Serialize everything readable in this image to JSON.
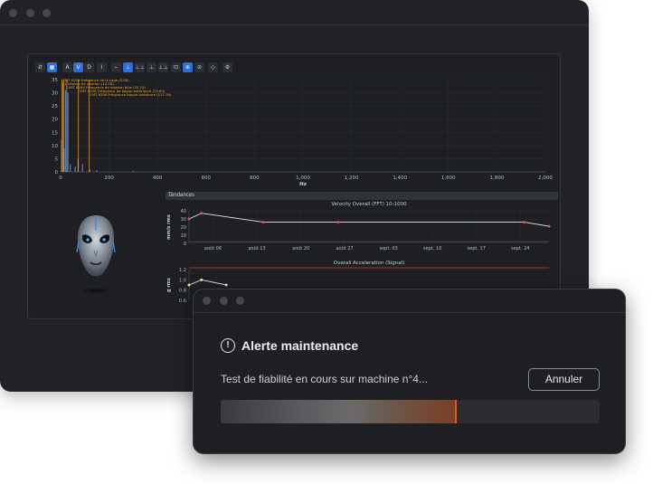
{
  "toolbar": {
    "buttons": [
      {
        "label": "⇵",
        "icon": "cursor-icon",
        "active": false
      },
      {
        "label": "▦",
        "icon": "select-icon",
        "active": true
      },
      {
        "label": "A",
        "icon": "a-icon",
        "active": false
      },
      {
        "label": "V",
        "icon": "v-icon",
        "active": true
      },
      {
        "label": "D",
        "icon": "d-icon",
        "active": false
      },
      {
        "label": "I",
        "icon": "i-icon",
        "active": false
      },
      {
        "label": "⎯",
        "icon": "line-icon",
        "active": false
      },
      {
        "label": "⊥",
        "icon": "marker-icon",
        "active": true
      },
      {
        "label": "⊥⊥",
        "icon": "harmonic-icon",
        "active": false
      },
      {
        "label": "⊥",
        "icon": "sideband-icon",
        "active": false
      },
      {
        "label": "⊥⊥",
        "icon": "peaks-icon",
        "active": false
      },
      {
        "label": "⊡",
        "icon": "zoom-icon",
        "active": false
      },
      {
        "label": "⊕",
        "icon": "zoom-in-icon",
        "active": true
      },
      {
        "label": "⊘",
        "icon": "reset-icon",
        "active": false
      },
      {
        "label": "◇",
        "icon": "fit-icon",
        "active": false
      },
      {
        "label": "⚙",
        "icon": "settings-icon",
        "active": false
      }
    ]
  },
  "chart_data": [
    {
      "type": "bar",
      "title": "",
      "xlabel": "Hz",
      "ylabel": "",
      "xlim": [
        0,
        2000
      ],
      "ylim": [
        0,
        35
      ],
      "x_ticks": [
        "0",
        "200",
        "400",
        "600",
        "800",
        "1,000",
        "1,200",
        "1,400",
        "1,600",
        "1,800",
        "2,000"
      ],
      "y_ticks": [
        "0",
        "5",
        "10",
        "15",
        "20",
        "25",
        "30",
        "35"
      ],
      "bars": [
        {
          "x": 4,
          "y": 12
        },
        {
          "x": 10,
          "y": 34
        },
        {
          "x": 14,
          "y": 9
        },
        {
          "x": 20,
          "y": 31
        },
        {
          "x": 30,
          "y": 30
        },
        {
          "x": 40,
          "y": 3
        },
        {
          "x": 60,
          "y": 2
        },
        {
          "x": 72,
          "y": 5
        },
        {
          "x": 90,
          "y": 3
        },
        {
          "x": 120,
          "y": 1
        },
        {
          "x": 150,
          "y": 0.6
        },
        {
          "x": 300,
          "y": 0.4
        }
      ],
      "markers": [
        {
          "x": 5.08,
          "label": "1MT 6206 Fréquence de la cage (5.08)"
        },
        {
          "x": 12.28,
          "label": "1 Vitesse de rotation (12.28)"
        },
        {
          "x": 25.7,
          "label": "1MT 6206 Fréquence de rotation bille (25.70)"
        },
        {
          "x": 73.6,
          "label": "1MT 6206 Fréquence de bague extérieure (73.60)"
        },
        {
          "x": 117.36,
          "label": "1MT 6206 Fréquence bague intérieure (117.36)"
        }
      ]
    },
    {
      "type": "line",
      "title": "Velocity Overall (FFT) 10-1000",
      "xlabel": "",
      "ylabel": "mm/s rms",
      "ylim": [
        0,
        40
      ],
      "y_ticks": [
        "0",
        "10",
        "20",
        "30",
        "40"
      ],
      "x_ticks": [
        "août 06",
        "août 13",
        "août 20",
        "août 27",
        "sept. 03",
        "sept. 10",
        "sept. 17",
        "sept. 24"
      ],
      "x_range": [
        0,
        29
      ],
      "series": [
        {
          "name": "",
          "x": [
            0,
            1,
            6,
            12,
            27,
            29
          ],
          "values": [
            30,
            37,
            26,
            26,
            26,
            21
          ]
        }
      ],
      "alarm_level": 2
    },
    {
      "type": "line",
      "title": "Overall Acceleration (Signal)",
      "xlabel": "",
      "ylabel": "g rms",
      "ylim": [
        0.6,
        1.2
      ],
      "y_ticks": [
        "0.6",
        "0.8",
        "1.0",
        "1.2"
      ],
      "x_range": [
        0,
        29
      ],
      "series": [
        {
          "name": "",
          "x": [
            0,
            1,
            3
          ],
          "values": [
            0.9,
            1.0,
            0.9
          ]
        }
      ]
    }
  ],
  "trends": {
    "header": "Tendances"
  },
  "dialog": {
    "title": "Alerte maintenance",
    "status": "Test de fiabilité en cours sur machine n°4...",
    "cancel_label": "Annuler",
    "progress": 0.62,
    "icon": "alert-circle-icon"
  },
  "colors": {
    "accent": "#2f6ed8",
    "marker": "#f0a030",
    "trend_line": "#e6e6e6",
    "trend_point": "#e05656",
    "alarm": "#d63b3b",
    "progress_edge": "#e0562a"
  }
}
